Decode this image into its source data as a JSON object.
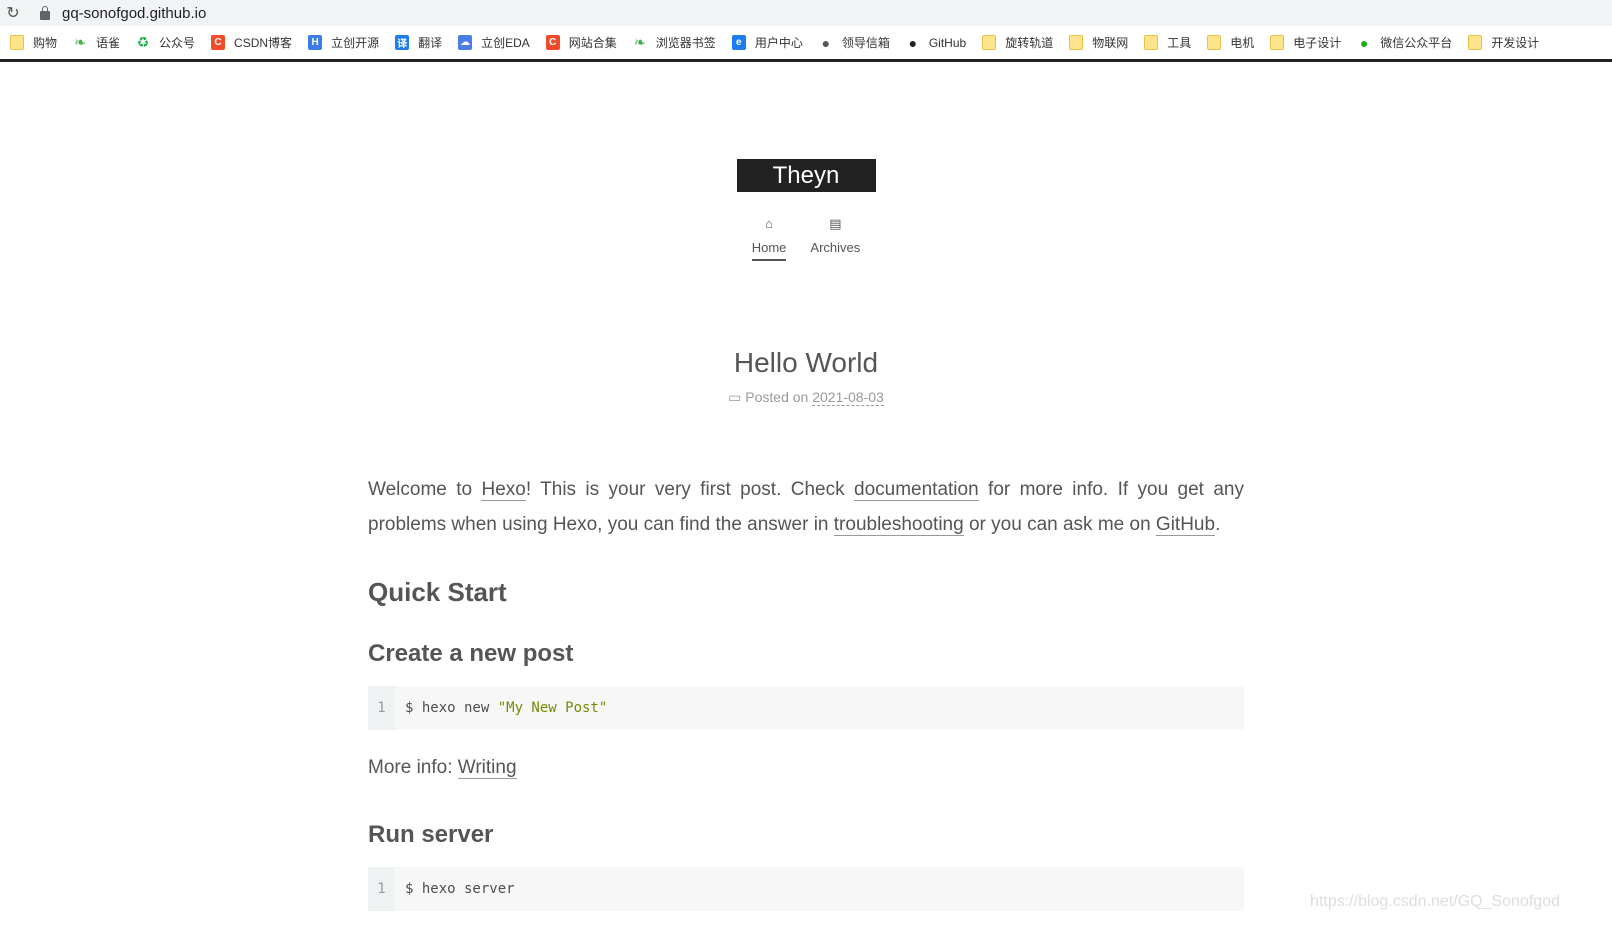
{
  "browser": {
    "url": "gq-sonofgod.github.io",
    "bookmarks": [
      {
        "label": "购物",
        "icon": "folder",
        "color": "#fde38a"
      },
      {
        "label": "语雀",
        "icon": "yuque",
        "color": "#3cb34a"
      },
      {
        "label": "公众号",
        "icon": "recycle",
        "color": "#20b14b"
      },
      {
        "label": "CSDN博客",
        "icon": "C",
        "color": "#f24b2a"
      },
      {
        "label": "立创开源",
        "icon": "H",
        "color": "#3b7ce8"
      },
      {
        "label": "翻译",
        "icon": "译",
        "color": "#1c7cf0"
      },
      {
        "label": "立创EDA",
        "icon": "cloud",
        "color": "#4a7de6"
      },
      {
        "label": "网站合集",
        "icon": "C",
        "color": "#f24b2a"
      },
      {
        "label": "浏览器书签",
        "icon": "yuque",
        "color": "#3cb34a"
      },
      {
        "label": "用户中心",
        "icon": "e",
        "color": "#1c7cf0"
      },
      {
        "label": "领导信箱",
        "icon": "globe",
        "color": "#555"
      },
      {
        "label": "GitHub",
        "icon": "github",
        "color": "#222"
      },
      {
        "label": "旋转轨道",
        "icon": "folder",
        "color": "#fde38a"
      },
      {
        "label": "物联网",
        "icon": "folder",
        "color": "#fde38a"
      },
      {
        "label": "工具",
        "icon": "folder",
        "color": "#fde38a"
      },
      {
        "label": "电机",
        "icon": "folder",
        "color": "#fde38a"
      },
      {
        "label": "电子设计",
        "icon": "folder",
        "color": "#fde38a"
      },
      {
        "label": "微信公众平台",
        "icon": "wechat",
        "color": "#1aad19"
      },
      {
        "label": "开发设计",
        "icon": "folder",
        "color": "#fde38a"
      }
    ]
  },
  "site": {
    "title": "Theyn",
    "nav": [
      {
        "label": "Home",
        "icon": "home-icon"
      },
      {
        "label": "Archives",
        "icon": "archive-icon"
      }
    ]
  },
  "post": {
    "title": "Hello World",
    "posted_on": "Posted on",
    "date": "2021-08-03",
    "intro": {
      "t1": "Welcome to ",
      "l1": "Hexo",
      "t2": "! This is your very first post. Check ",
      "l2": "documentation",
      "t3": " for more info. If you get any problems when using Hexo, you can find the answer in ",
      "l3": "troubleshooting",
      "t4": " or you can ask me on ",
      "l4": "GitHub",
      "t5": "."
    },
    "h_quick": "Quick Start",
    "h_create": "Create a new post",
    "code1": {
      "ln": "1",
      "cmd": "$ hexo new ",
      "str": "\"My New Post\""
    },
    "more_info": "More info: ",
    "more_link": "Writing",
    "h_run": "Run server",
    "code2": {
      "ln": "1",
      "cmd": "$ hexo server"
    }
  },
  "watermark": "https://blog.csdn.net/GQ_Sonofgod"
}
